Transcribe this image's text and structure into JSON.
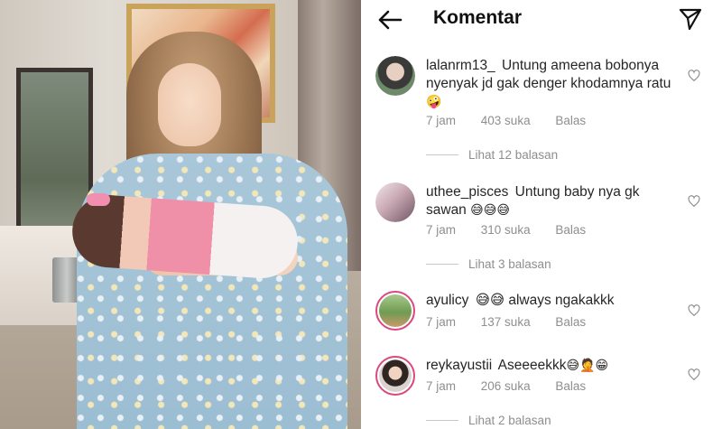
{
  "header": {
    "title": "Komentar",
    "back_icon": "arrow-left-icon",
    "send_icon": "paper-plane-icon"
  },
  "comments": [
    {
      "username": "lalanrm13_",
      "text": "Untung ameena bobonya nyenyak jd gak denger khodamnya ratu",
      "emoji": "🤪",
      "time": "7 jam",
      "likes": "403 suka",
      "reply": "Balas",
      "view_replies": "Lihat 12 balasan"
    },
    {
      "username": "uthee_pisces",
      "text": "Untung baby nya gk sawan",
      "emoji": "😅😅😅",
      "time": "7 jam",
      "likes": "310 suka",
      "reply": "Balas",
      "view_replies": "Lihat 3 balasan"
    },
    {
      "username": "ayulicy",
      "text": "😅😅 always ngakakkk",
      "emoji": "",
      "time": "7 jam",
      "likes": "137 suka",
      "reply": "Balas",
      "view_replies": ""
    },
    {
      "username": "reykayustii",
      "text": "Aseeeekkk",
      "emoji": "😅🤦😁",
      "time": "7 jam",
      "likes": "206 suka",
      "reply": "Balas",
      "view_replies": "Lihat 2 balasan"
    }
  ],
  "colors": {
    "text": "#262626",
    "muted": "#8e8e8e",
    "story_ring": "#d9487f"
  }
}
